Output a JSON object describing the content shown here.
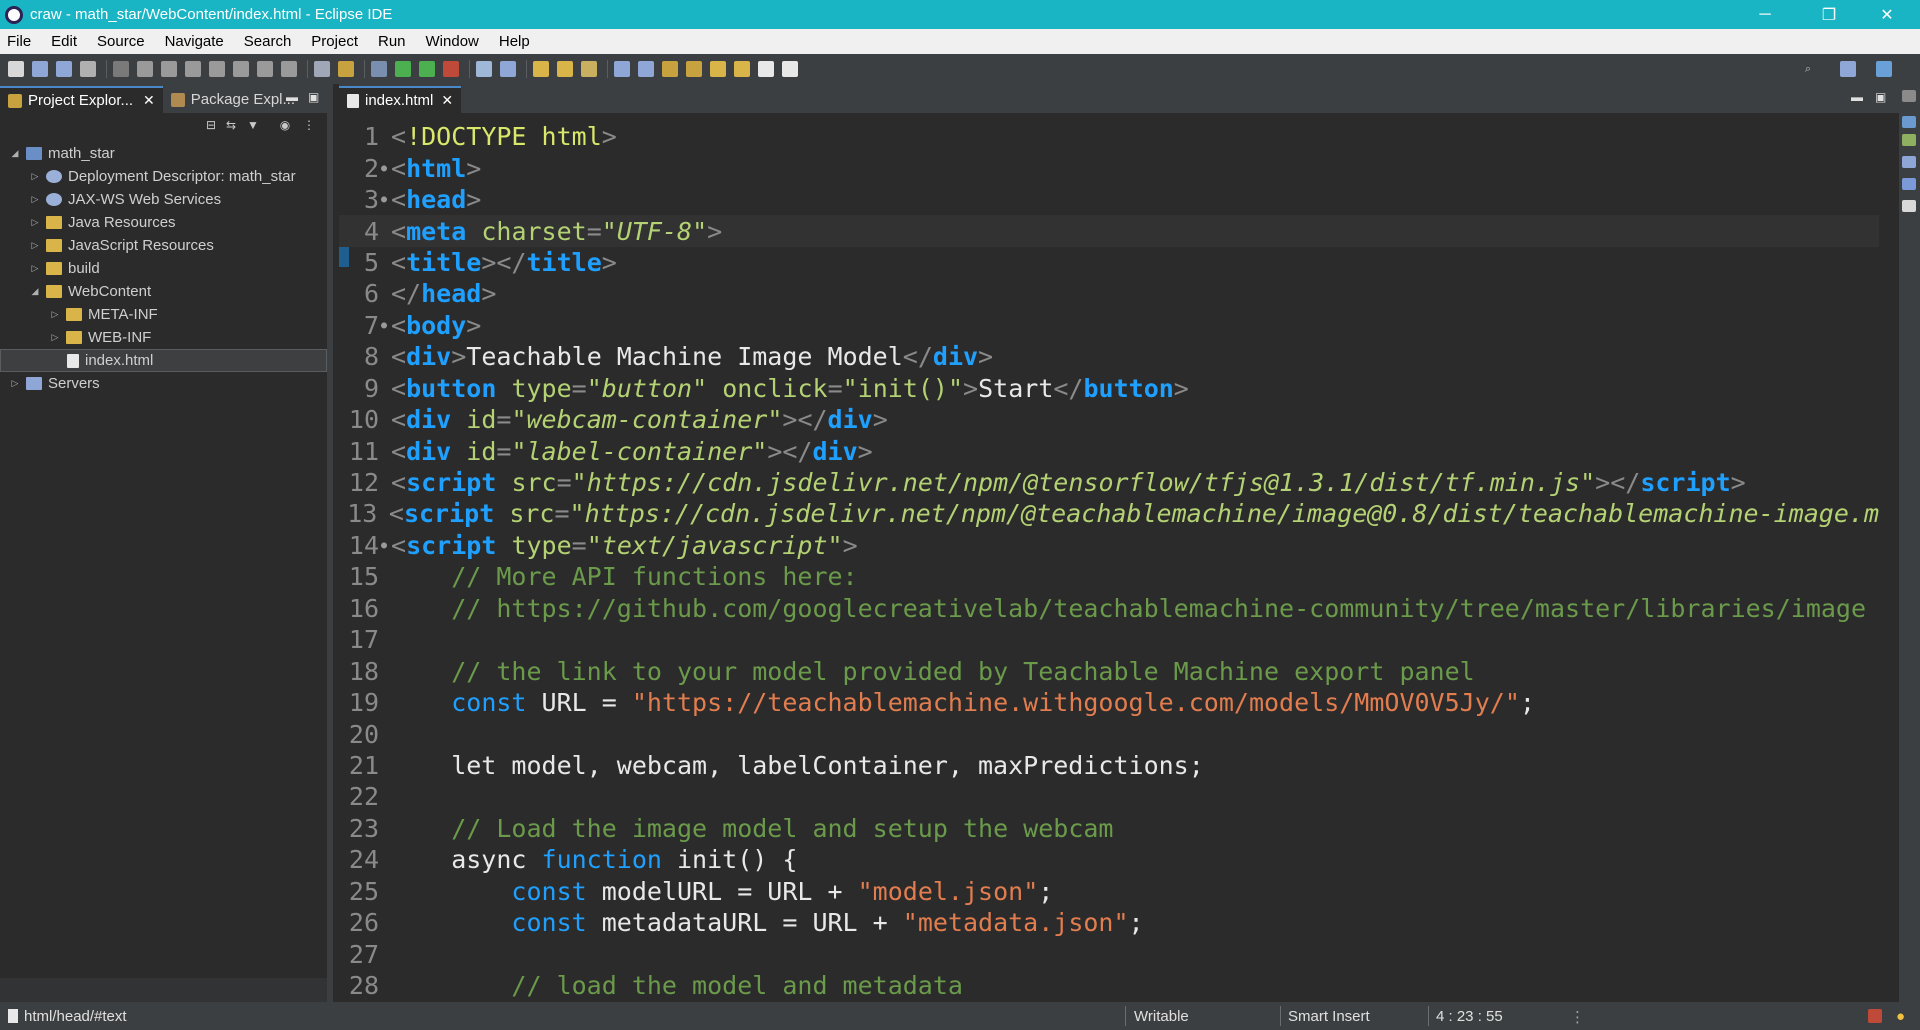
{
  "window": {
    "title": "craw - math_star/WebContent/index.html - Eclipse IDE",
    "controls": [
      "─",
      "❐",
      "✕"
    ]
  },
  "menu": [
    "File",
    "Edit",
    "Source",
    "Navigate",
    "Search",
    "Project",
    "Run",
    "Window",
    "Help"
  ],
  "left_panel": {
    "tabs": [
      {
        "label": "Project Explor...",
        "active": true
      },
      {
        "label": "Package Expl...",
        "active": false
      }
    ],
    "tree": [
      {
        "label": "math_star",
        "depth": 0,
        "expanded": true,
        "icon": "project-icon"
      },
      {
        "label": "Deployment Descriptor: math_star",
        "depth": 1,
        "expanded": false,
        "icon": "descriptor-icon"
      },
      {
        "label": "JAX-WS Web Services",
        "depth": 1,
        "expanded": false,
        "icon": "webservice-icon"
      },
      {
        "label": "Java Resources",
        "depth": 1,
        "expanded": false,
        "icon": "folder-icon"
      },
      {
        "label": "JavaScript Resources",
        "depth": 1,
        "expanded": false,
        "icon": "folder-icon"
      },
      {
        "label": "build",
        "depth": 1,
        "expanded": false,
        "icon": "folder-icon"
      },
      {
        "label": "WebContent",
        "depth": 1,
        "expanded": true,
        "icon": "folder-icon"
      },
      {
        "label": "META-INF",
        "depth": 2,
        "expanded": false,
        "icon": "folder-icon"
      },
      {
        "label": "WEB-INF",
        "depth": 2,
        "expanded": false,
        "icon": "folder-icon"
      },
      {
        "label": "index.html",
        "depth": 2,
        "expanded": null,
        "icon": "html-file-icon",
        "selected": true
      },
      {
        "label": "Servers",
        "depth": 0,
        "expanded": false,
        "icon": "server-folder-icon"
      }
    ]
  },
  "editor": {
    "tab_label": "index.html",
    "current_line": 4,
    "lines": [
      {
        "n": "1",
        "fold": false,
        "tokens": [
          [
            "br",
            "<"
          ],
          [
            "dt",
            "!DOCTYPE"
          ],
          [
            "txt",
            " "
          ],
          [
            "dt",
            "html"
          ],
          [
            "br",
            ">"
          ]
        ]
      },
      {
        "n": "2",
        "fold": true,
        "tokens": [
          [
            "br",
            "<"
          ],
          [
            "kw",
            "html"
          ],
          [
            "br",
            ">"
          ]
        ]
      },
      {
        "n": "3",
        "fold": true,
        "tokens": [
          [
            "br",
            "<"
          ],
          [
            "kw",
            "head"
          ],
          [
            "br",
            ">"
          ]
        ]
      },
      {
        "n": "4",
        "fold": false,
        "tokens": [
          [
            "br",
            "<"
          ],
          [
            "kw",
            "meta"
          ],
          [
            "txt",
            " "
          ],
          [
            "at",
            "charset"
          ],
          [
            "br",
            "="
          ],
          [
            "st",
            "\"UTF-8\""
          ],
          [
            "br",
            ">"
          ]
        ]
      },
      {
        "n": "5",
        "fold": false,
        "tokens": [
          [
            "br",
            "<"
          ],
          [
            "kw",
            "title"
          ],
          [
            "br",
            "></"
          ],
          [
            "kw",
            "title"
          ],
          [
            "br",
            ">"
          ]
        ]
      },
      {
        "n": "6",
        "fold": false,
        "tokens": [
          [
            "br",
            "</"
          ],
          [
            "kw",
            "head"
          ],
          [
            "br",
            ">"
          ]
        ]
      },
      {
        "n": "7",
        "fold": true,
        "tokens": [
          [
            "br",
            "<"
          ],
          [
            "kw",
            "body"
          ],
          [
            "br",
            ">"
          ]
        ]
      },
      {
        "n": "8",
        "fold": false,
        "tokens": [
          [
            "br",
            "<"
          ],
          [
            "kw",
            "div"
          ],
          [
            "br",
            ">"
          ],
          [
            "txt",
            "Teachable Machine Image Model"
          ],
          [
            "br",
            "</"
          ],
          [
            "kw",
            "div"
          ],
          [
            "br",
            ">"
          ]
        ]
      },
      {
        "n": "9",
        "fold": false,
        "tokens": [
          [
            "br",
            "<"
          ],
          [
            "kw",
            "button"
          ],
          [
            "txt",
            " "
          ],
          [
            "at",
            "type"
          ],
          [
            "br",
            "="
          ],
          [
            "st",
            "\"button\""
          ],
          [
            "txt",
            " "
          ],
          [
            "at",
            "onclick"
          ],
          [
            "br",
            "="
          ],
          [
            "at",
            "\"init()\""
          ],
          [
            "br",
            ">"
          ],
          [
            "txt",
            "Start"
          ],
          [
            "br",
            "</"
          ],
          [
            "kw",
            "button"
          ],
          [
            "br",
            ">"
          ]
        ]
      },
      {
        "n": "10",
        "fold": false,
        "tokens": [
          [
            "br",
            "<"
          ],
          [
            "kw",
            "div"
          ],
          [
            "txt",
            " "
          ],
          [
            "at",
            "id"
          ],
          [
            "br",
            "="
          ],
          [
            "st",
            "\"webcam-container\""
          ],
          [
            "br",
            "></"
          ],
          [
            "kw",
            "div"
          ],
          [
            "br",
            ">"
          ]
        ]
      },
      {
        "n": "11",
        "fold": false,
        "tokens": [
          [
            "br",
            "<"
          ],
          [
            "kw",
            "div"
          ],
          [
            "txt",
            " "
          ],
          [
            "at",
            "id"
          ],
          [
            "br",
            "="
          ],
          [
            "st",
            "\"label-container\""
          ],
          [
            "br",
            "></"
          ],
          [
            "kw",
            "div"
          ],
          [
            "br",
            ">"
          ]
        ]
      },
      {
        "n": "12",
        "fold": false,
        "tokens": [
          [
            "br",
            "<"
          ],
          [
            "kw",
            "script"
          ],
          [
            "txt",
            " "
          ],
          [
            "at",
            "src"
          ],
          [
            "br",
            "="
          ],
          [
            "st",
            "\"https://cdn.jsdelivr.net/npm/@tensorflow/tfjs@1.3.1/dist/tf.min.js\""
          ],
          [
            "br",
            "></"
          ],
          [
            "kw",
            "script"
          ],
          [
            "br",
            ">"
          ]
        ]
      },
      {
        "n": "13",
        "fold": false,
        "tokens": [
          [
            "br",
            "<"
          ],
          [
            "kw",
            "script"
          ],
          [
            "txt",
            " "
          ],
          [
            "at",
            "src"
          ],
          [
            "br",
            "="
          ],
          [
            "st",
            "\"https://cdn.jsdelivr.net/npm/@teachablemachine/image@0.8/dist/teachablemachine-image.m"
          ]
        ]
      },
      {
        "n": "14",
        "fold": true,
        "tokens": [
          [
            "br",
            "<"
          ],
          [
            "kw",
            "script"
          ],
          [
            "txt",
            " "
          ],
          [
            "at",
            "type"
          ],
          [
            "br",
            "="
          ],
          [
            "st",
            "\"text/javascript\""
          ],
          [
            "br",
            ">"
          ]
        ]
      },
      {
        "n": "15",
        "fold": false,
        "tokens": [
          [
            "txt",
            "    "
          ],
          [
            "cm",
            "// More API functions here:"
          ]
        ]
      },
      {
        "n": "16",
        "fold": false,
        "tokens": [
          [
            "txt",
            "    "
          ],
          [
            "cm",
            "// https://github.com/googlecreativelab/teachablemachine-community/tree/master/libraries/image"
          ]
        ]
      },
      {
        "n": "17",
        "fold": false,
        "tokens": []
      },
      {
        "n": "18",
        "fold": false,
        "tokens": [
          [
            "txt",
            "    "
          ],
          [
            "cm",
            "// the link to your model provided by Teachable Machine export panel"
          ]
        ]
      },
      {
        "n": "19",
        "fold": false,
        "tokens": [
          [
            "txt",
            "    "
          ],
          [
            "jskw",
            "const"
          ],
          [
            "txt",
            " URL = "
          ],
          [
            "jsstr",
            "\"https://teachablemachine.withgoogle.com/models/MmOV0V5Jy/\""
          ],
          [
            "txt",
            ";"
          ]
        ]
      },
      {
        "n": "20",
        "fold": false,
        "tokens": []
      },
      {
        "n": "21",
        "fold": false,
        "tokens": [
          [
            "txt",
            "    let model, webcam, labelContainer, maxPredictions;"
          ]
        ]
      },
      {
        "n": "22",
        "fold": false,
        "tokens": []
      },
      {
        "n": "23",
        "fold": false,
        "tokens": [
          [
            "txt",
            "    "
          ],
          [
            "cm",
            "// Load the image model and setup the webcam"
          ]
        ]
      },
      {
        "n": "24",
        "fold": false,
        "tokens": [
          [
            "txt",
            "    async "
          ],
          [
            "jskw",
            "function"
          ],
          [
            "txt",
            " init() {"
          ]
        ]
      },
      {
        "n": "25",
        "fold": false,
        "tokens": [
          [
            "txt",
            "        "
          ],
          [
            "jskw",
            "const"
          ],
          [
            "txt",
            " modelURL = URL + "
          ],
          [
            "jsstr",
            "\"model.json\""
          ],
          [
            "txt",
            ";"
          ]
        ]
      },
      {
        "n": "26",
        "fold": false,
        "tokens": [
          [
            "txt",
            "        "
          ],
          [
            "jskw",
            "const"
          ],
          [
            "txt",
            " metadataURL = URL + "
          ],
          [
            "jsstr",
            "\"metadata.json\""
          ],
          [
            "txt",
            ";"
          ]
        ]
      },
      {
        "n": "27",
        "fold": false,
        "tokens": []
      },
      {
        "n": "28",
        "fold": false,
        "tokens": [
          [
            "txt",
            "        "
          ],
          [
            "cm",
            "// load the model and metadata"
          ]
        ]
      }
    ]
  },
  "status": {
    "path": "html/head/#text",
    "mode": "Writable",
    "insert": "Smart Insert",
    "position": "4 : 23 : 55"
  },
  "colors": {
    "titlebar": "#19b5c4",
    "editor_bg": "#2b2b2b",
    "keyword": "#1fa0ff",
    "attribute": "#b4d273",
    "comment": "#6a9a4a",
    "js_string": "#e27d4f"
  }
}
